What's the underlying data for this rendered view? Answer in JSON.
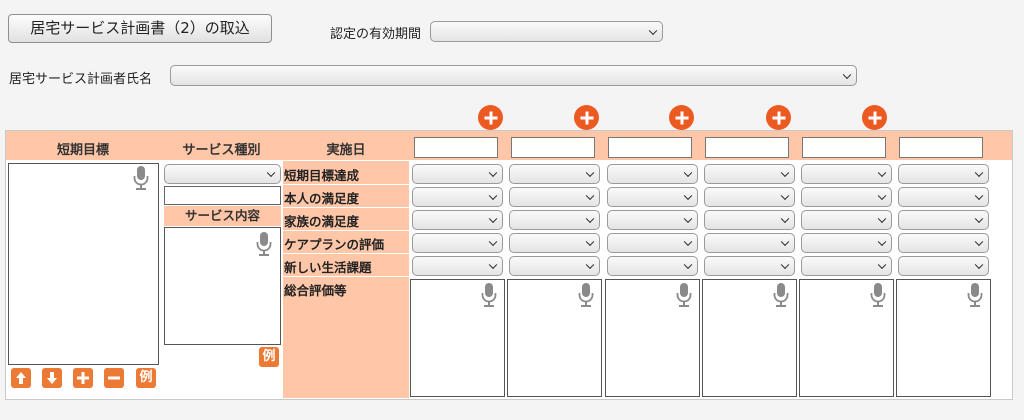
{
  "import_button_label": "居宅サービス計画書（2）の取込",
  "validity_label": "認定の有効期間",
  "planner_label": "居宅サービス計画者氏名",
  "headers": {
    "short_term_goal": "短期目標",
    "service_type": "サービス種別",
    "implementation_date": "実施日",
    "service_content": "サービス内容"
  },
  "row_labels": [
    "短期目標達成",
    "本人の満足度",
    "家族の満足度",
    "ケアプランの評価",
    "新しい生活課題"
  ],
  "overall_label": "総合評価等",
  "example_label": "例",
  "accent_color": "#ec5a22",
  "header_bg": "#ffc7a8",
  "icons": [
    "plus-circle-icon",
    "chevron-down-icon",
    "microphone-icon",
    "arrow-up-icon",
    "arrow-down-icon",
    "minus-icon"
  ]
}
